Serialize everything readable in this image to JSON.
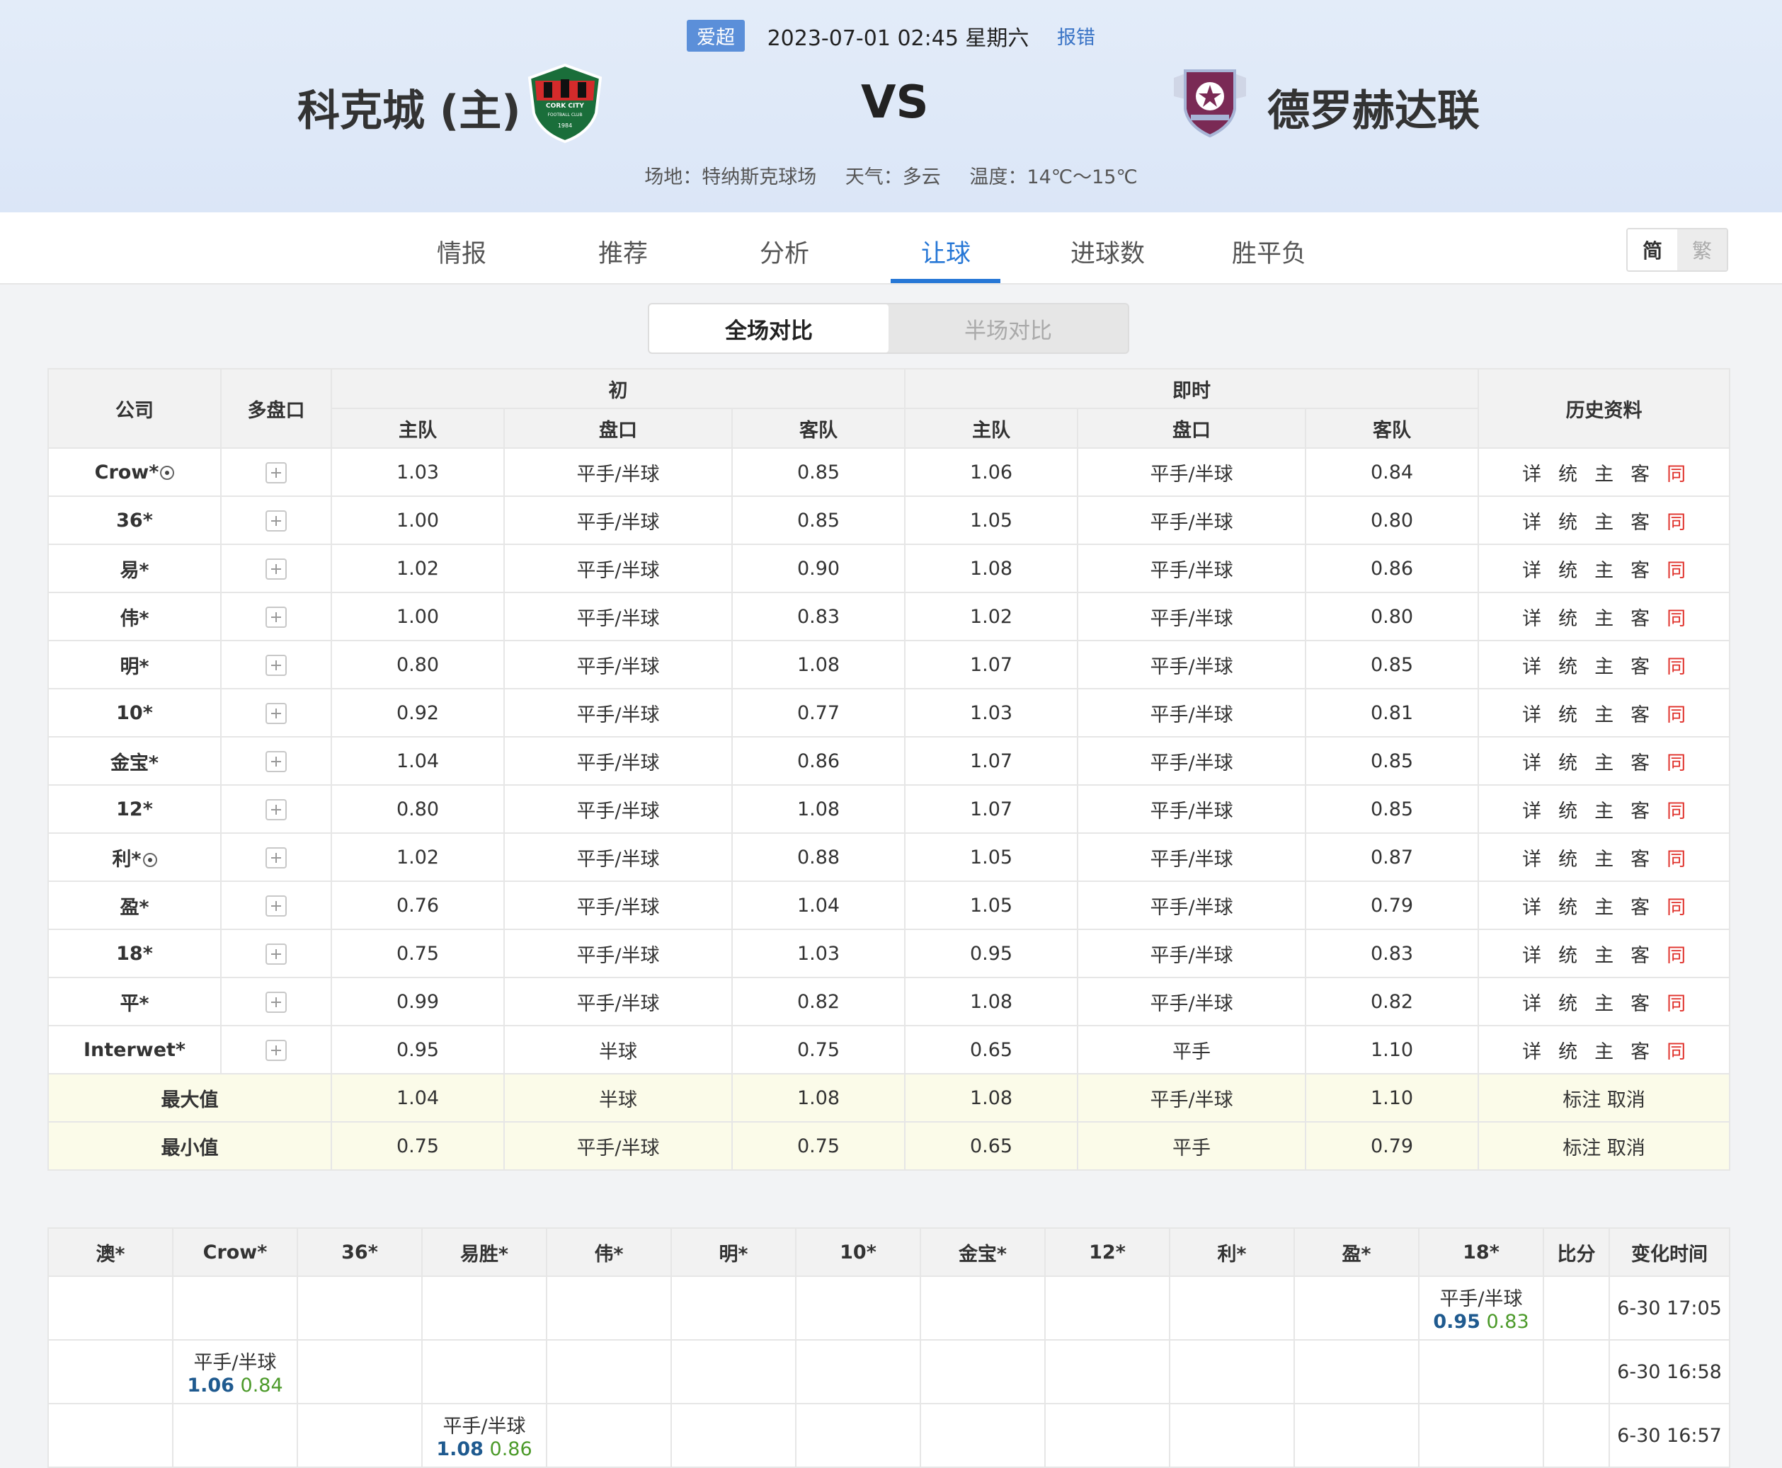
{
  "header": {
    "league": "爱超",
    "datetime": "2023-07-01 02:45 星期六",
    "report": "报错",
    "home_team": "科克城 (主)",
    "vs": "VS",
    "away_team": "德罗赫达联",
    "home_logo_text": [
      "CORK CITY",
      "FOOTBALL CLUB",
      "1984"
    ],
    "venue": "场地：特纳斯克球场",
    "weather": "天气：多云",
    "temperature": "温度：14℃～15℃"
  },
  "tabs": [
    "情报",
    "推荐",
    "分析",
    "让球",
    "进球数",
    "胜平负"
  ],
  "active_tab": "让球",
  "lang": {
    "simplified": "简",
    "traditional": "繁"
  },
  "segment": {
    "full": "全场对比",
    "half": "半场对比"
  },
  "odds_table": {
    "headers": {
      "company": "公司",
      "multi": "多盘口",
      "initial": "初",
      "live": "即时",
      "history": "历史资料",
      "home": "主队",
      "line": "盘口",
      "away": "客队"
    },
    "history_links": [
      "详",
      "统",
      "主",
      "客",
      "同"
    ],
    "rows": [
      {
        "company": "Crow*",
        "ball": true,
        "ih": "1.03",
        "il": "平手/半球",
        "ia": "0.85",
        "lh": "1.06",
        "ll": "平手/半球",
        "la": "0.84"
      },
      {
        "company": "36*",
        "ball": false,
        "ih": "1.00",
        "il": "平手/半球",
        "ia": "0.85",
        "lh": "1.05",
        "ll": "平手/半球",
        "la": "0.80"
      },
      {
        "company": "易*",
        "ball": false,
        "ih": "1.02",
        "il": "平手/半球",
        "ia": "0.90",
        "lh": "1.08",
        "ll": "平手/半球",
        "la": "0.86"
      },
      {
        "company": "伟*",
        "ball": false,
        "ih": "1.00",
        "il": "平手/半球",
        "ia": "0.83",
        "lh": "1.02",
        "ll": "平手/半球",
        "la": "0.80"
      },
      {
        "company": "明*",
        "ball": false,
        "ih": "0.80",
        "il": "平手/半球",
        "ia": "1.08",
        "lh": "1.07",
        "ll": "平手/半球",
        "la": "0.85"
      },
      {
        "company": "10*",
        "ball": false,
        "ih": "0.92",
        "il": "平手/半球",
        "ia": "0.77",
        "lh": "1.03",
        "ll": "平手/半球",
        "la": "0.81"
      },
      {
        "company": "金宝*",
        "ball": false,
        "ih": "1.04",
        "il": "平手/半球",
        "ia": "0.86",
        "lh": "1.07",
        "ll": "平手/半球",
        "la": "0.85"
      },
      {
        "company": "12*",
        "ball": false,
        "ih": "0.80",
        "il": "平手/半球",
        "ia": "1.08",
        "lh": "1.07",
        "ll": "平手/半球",
        "la": "0.85"
      },
      {
        "company": "利*",
        "ball": true,
        "ih": "1.02",
        "il": "平手/半球",
        "ia": "0.88",
        "lh": "1.05",
        "ll": "平手/半球",
        "la": "0.87"
      },
      {
        "company": "盈*",
        "ball": false,
        "ih": "0.76",
        "il": "平手/半球",
        "ia": "1.04",
        "lh": "1.05",
        "ll": "平手/半球",
        "la": "0.79"
      },
      {
        "company": "18*",
        "ball": false,
        "ih": "0.75",
        "il": "平手/半球",
        "ia": "1.03",
        "lh": "0.95",
        "ll": "平手/半球",
        "la": "0.83"
      },
      {
        "company": "平*",
        "ball": false,
        "ih": "0.99",
        "il": "平手/半球",
        "ia": "0.82",
        "lh": "1.08",
        "ll": "平手/半球",
        "la": "0.82"
      },
      {
        "company": "Interwet*",
        "ball": false,
        "ih": "0.95",
        "il": "半球",
        "ia": "0.75",
        "lh": "0.65",
        "ll": "平手",
        "la": "1.10"
      }
    ],
    "stats": [
      {
        "label": "最大值",
        "ih": "1.04",
        "il": "半球",
        "ia": "1.08",
        "lh": "1.08",
        "ll": "平手/半球",
        "la": "1.10",
        "actions": "标注 取消"
      },
      {
        "label": "最小值",
        "ih": "0.75",
        "il": "平手/半球",
        "ia": "0.75",
        "lh": "0.65",
        "ll": "平手",
        "la": "0.79",
        "actions": "标注 取消"
      }
    ]
  },
  "change_table": {
    "headers": [
      "澳*",
      "Crow*",
      "36*",
      "易胜*",
      "伟*",
      "明*",
      "10*",
      "金宝*",
      "12*",
      "利*",
      "盈*",
      "18*",
      "比分",
      "变化时间"
    ],
    "rows": [
      {
        "col": 11,
        "line": "平手/半球",
        "home": "0.95",
        "away": "0.83",
        "time": "6-30 17:05"
      },
      {
        "col": 1,
        "line": "平手/半球",
        "home": "1.06",
        "away": "0.84",
        "time": "6-30 16:58"
      },
      {
        "col": 3,
        "line": "平手/半球",
        "home": "1.08",
        "away": "0.86",
        "time": "6-30 16:57"
      }
    ]
  },
  "colors": {
    "accent": "#2677d6",
    "league_badge": "#5b8fd9",
    "red_link": "#e0312b",
    "home_odds": "#1f5a8f",
    "away_odds": "#4c9a2a",
    "stat_row": "#fbfbe9"
  }
}
